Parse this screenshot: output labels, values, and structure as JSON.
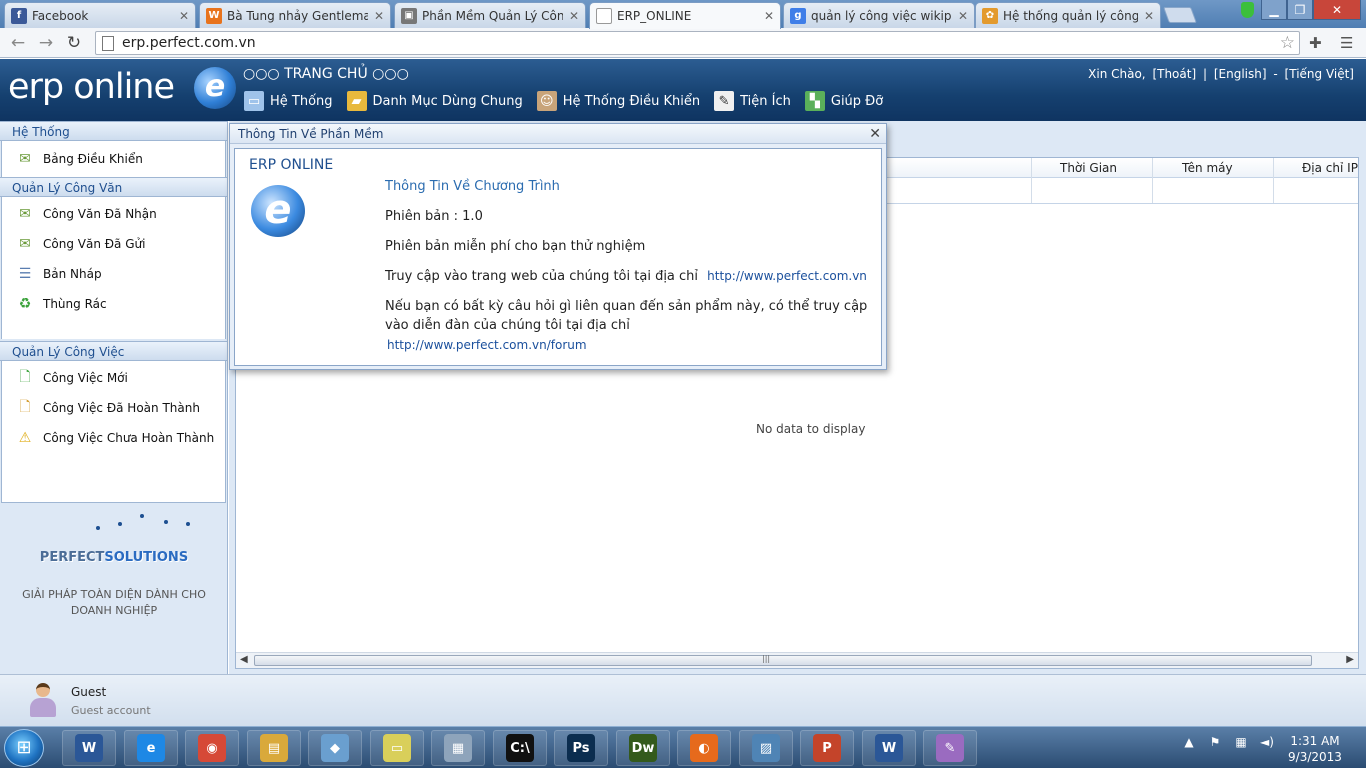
{
  "browser": {
    "tabs": [
      {
        "title": "Facebook",
        "icon": "facebook-icon",
        "color": "#3b5998",
        "glyph": "f"
      },
      {
        "title": "Bà Tung nhảy Gentleman",
        "icon": "wattpad-icon",
        "color": "#e8731c",
        "glyph": "W"
      },
      {
        "title": "Phần Mềm Quản Lý Công",
        "icon": "page-icon",
        "color": "#777777",
        "glyph": "▣"
      },
      {
        "title": "ERP_ONLINE",
        "icon": "blank-page-icon",
        "color": "#ffffff",
        "glyph": ""
      },
      {
        "title": "quản lý công việc wikiped",
        "icon": "google-icon",
        "color": "#3f7ee8",
        "glyph": "g"
      },
      {
        "title": "Hệ thống quản lý công vi",
        "icon": "site-icon",
        "color": "#e39a2d",
        "glyph": "✿"
      }
    ],
    "url": "erp.perfect.com.vn"
  },
  "header": {
    "logo_text": "erp online",
    "logo_glyph": "e",
    "home_title": "○○○ TRANG CHỦ ○○○",
    "greeting": "Xin Chào,",
    "logout": "[Thoát]",
    "sep1": "|",
    "english": "[English]",
    "sep2": "-",
    "vietnamese": "[Tiếng Việt]",
    "menu": [
      {
        "label": "Hệ Thống",
        "icon": "computer-icon"
      },
      {
        "label": "Danh Mục Dùng Chung",
        "icon": "folder-icon"
      },
      {
        "label": "Hệ Thống Điều Khiển",
        "icon": "users-icon"
      },
      {
        "label": "Tiện Ích",
        "icon": "notepad-icon"
      },
      {
        "label": "Giúp Đỡ",
        "icon": "help-icon"
      }
    ]
  },
  "sidebar": {
    "sections": [
      {
        "title": "Hệ Thống",
        "items": [
          {
            "label": "Bảng Điều Khiển",
            "icon": "mail-icon"
          }
        ]
      },
      {
        "title": "Quản Lý Công Văn",
        "items": [
          {
            "label": "Công Văn Đã Nhận",
            "icon": "mail-receive-icon"
          },
          {
            "label": "Công Văn Đã Gửi",
            "icon": "mail-send-icon"
          },
          {
            "label": "Bản Nháp",
            "icon": "draft-icon"
          },
          {
            "label": "Thùng Rác",
            "icon": "trash-icon"
          }
        ]
      },
      {
        "title": "Quản Lý Công Việc",
        "items": [
          {
            "label": "Công Việc Mới",
            "icon": "new-task-icon"
          },
          {
            "label": "Công Việc Đã Hoàn Thành",
            "icon": "done-task-icon"
          },
          {
            "label": "Công Việc Chưa Hoàn Thành",
            "icon": "pending-task-icon"
          }
        ]
      }
    ],
    "brand_name_a": "PERFECT",
    "brand_name_b": "SOLUTIONS",
    "brand_slogan": "GIẢI PHÁP TOÀN DIỆN DÀNH CHO DOANH NGHIỆP"
  },
  "grid": {
    "columns": [
      "Thời Gian",
      "Tên máy",
      "Địa chỉ IP"
    ],
    "empty_text": "No data to display"
  },
  "dialog": {
    "title": "Thông Tin Về Phần Mềm",
    "app_name": "ERP ONLINE",
    "heading": "Thông Tin Về Chương Trình",
    "version": "Phiên bản : 1.0",
    "free_note": "Phiên bản miễn phí cho bạn thử nghiệm",
    "visit_text": "Truy cập vào trang web của chúng tôi tại địa chỉ",
    "site_url": "http://www.perfect.com.vn",
    "forum_text_1": "Nếu bạn có bất kỳ câu hỏi gì liên quan đến sản phẩm này, có thể truy cập",
    "forum_text_2": "vào diễn đàn của chúng tôi tại địa chỉ",
    "forum_url": "http://www.perfect.com.vn/forum"
  },
  "user": {
    "name": "Guest",
    "role": "Guest account"
  },
  "taskbar": {
    "apps": [
      {
        "name": "word-icon",
        "glyph": "W",
        "color": "#2b5797"
      },
      {
        "name": "internet-explorer-icon",
        "glyph": "e",
        "color": "#1e88e5"
      },
      {
        "name": "chrome-icon",
        "glyph": "◉",
        "color": "#d64937"
      },
      {
        "name": "file-explorer-icon",
        "glyph": "▤",
        "color": "#d9a93b"
      },
      {
        "name": "app-icon",
        "glyph": "◆",
        "color": "#6a9fcf"
      },
      {
        "name": "sticky-notes-icon",
        "glyph": "▭",
        "color": "#d9cf5a"
      },
      {
        "name": "calculator-icon",
        "glyph": "▦",
        "color": "#8ea4bb"
      },
      {
        "name": "command-prompt-icon",
        "glyph": "C:\\",
        "color": "#111111"
      },
      {
        "name": "photoshop-icon",
        "glyph": "Ps",
        "color": "#0b2d4f"
      },
      {
        "name": "dreamweaver-icon",
        "glyph": "Dw",
        "color": "#345a1c"
      },
      {
        "name": "firefox-icon",
        "glyph": "◐",
        "color": "#e66a1c"
      },
      {
        "name": "image-viewer-icon",
        "glyph": "▨",
        "color": "#4f84b5"
      },
      {
        "name": "powerpoint-icon",
        "glyph": "P",
        "color": "#c4442a"
      },
      {
        "name": "word-doc-icon",
        "glyph": "W",
        "color": "#2b5797"
      },
      {
        "name": "paint-icon",
        "glyph": "✎",
        "color": "#9a6bc0"
      }
    ],
    "time": "1:31 AM",
    "date": "9/3/2013"
  }
}
